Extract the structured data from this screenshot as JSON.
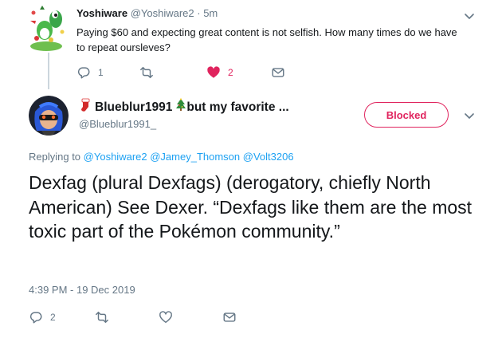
{
  "parent_tweet": {
    "display_name": "Yoshiware",
    "handle": "@Yoshiware2",
    "separator": " · ",
    "time": "5m",
    "text": "Paying $60 and expecting great content is not selfish. How many times do we have to repeat oursleves?",
    "actions": {
      "reply_count": "1",
      "retweet_count": "",
      "like_count": "2",
      "liked": true
    }
  },
  "reply_tweet": {
    "display_name": "Blueblur1991",
    "display_name_suffix": " but my favorite ...",
    "handle": "@Blueblur1991_",
    "blocked_label": "Blocked",
    "replying_prefix": "Replying to",
    "replying_to": [
      "@Yoshiware2",
      "@Jamey_Thomson",
      "@Volt3206"
    ],
    "text": "Dexfag (plural Dexfags) (derogatory, chiefly North American) See Dexer. “Dexfags like them are the most toxic part of the Pokémon community.”",
    "timestamp": "4:39 PM - 19 Dec 2019",
    "actions": {
      "reply_count": "2",
      "retweet_count": "",
      "like_count": ""
    }
  },
  "colors": {
    "text": "#14171a",
    "muted": "#657786",
    "link": "#1da1f2",
    "like_red": "#e0245e",
    "blocked_red": "#e0245e",
    "divider": "#ccd6dd"
  },
  "icons": [
    "reply-icon",
    "retweet-icon",
    "heart-icon",
    "message-icon",
    "chevron-down-icon",
    "christmas-stocking-icon",
    "christmas-tree-icon"
  ]
}
